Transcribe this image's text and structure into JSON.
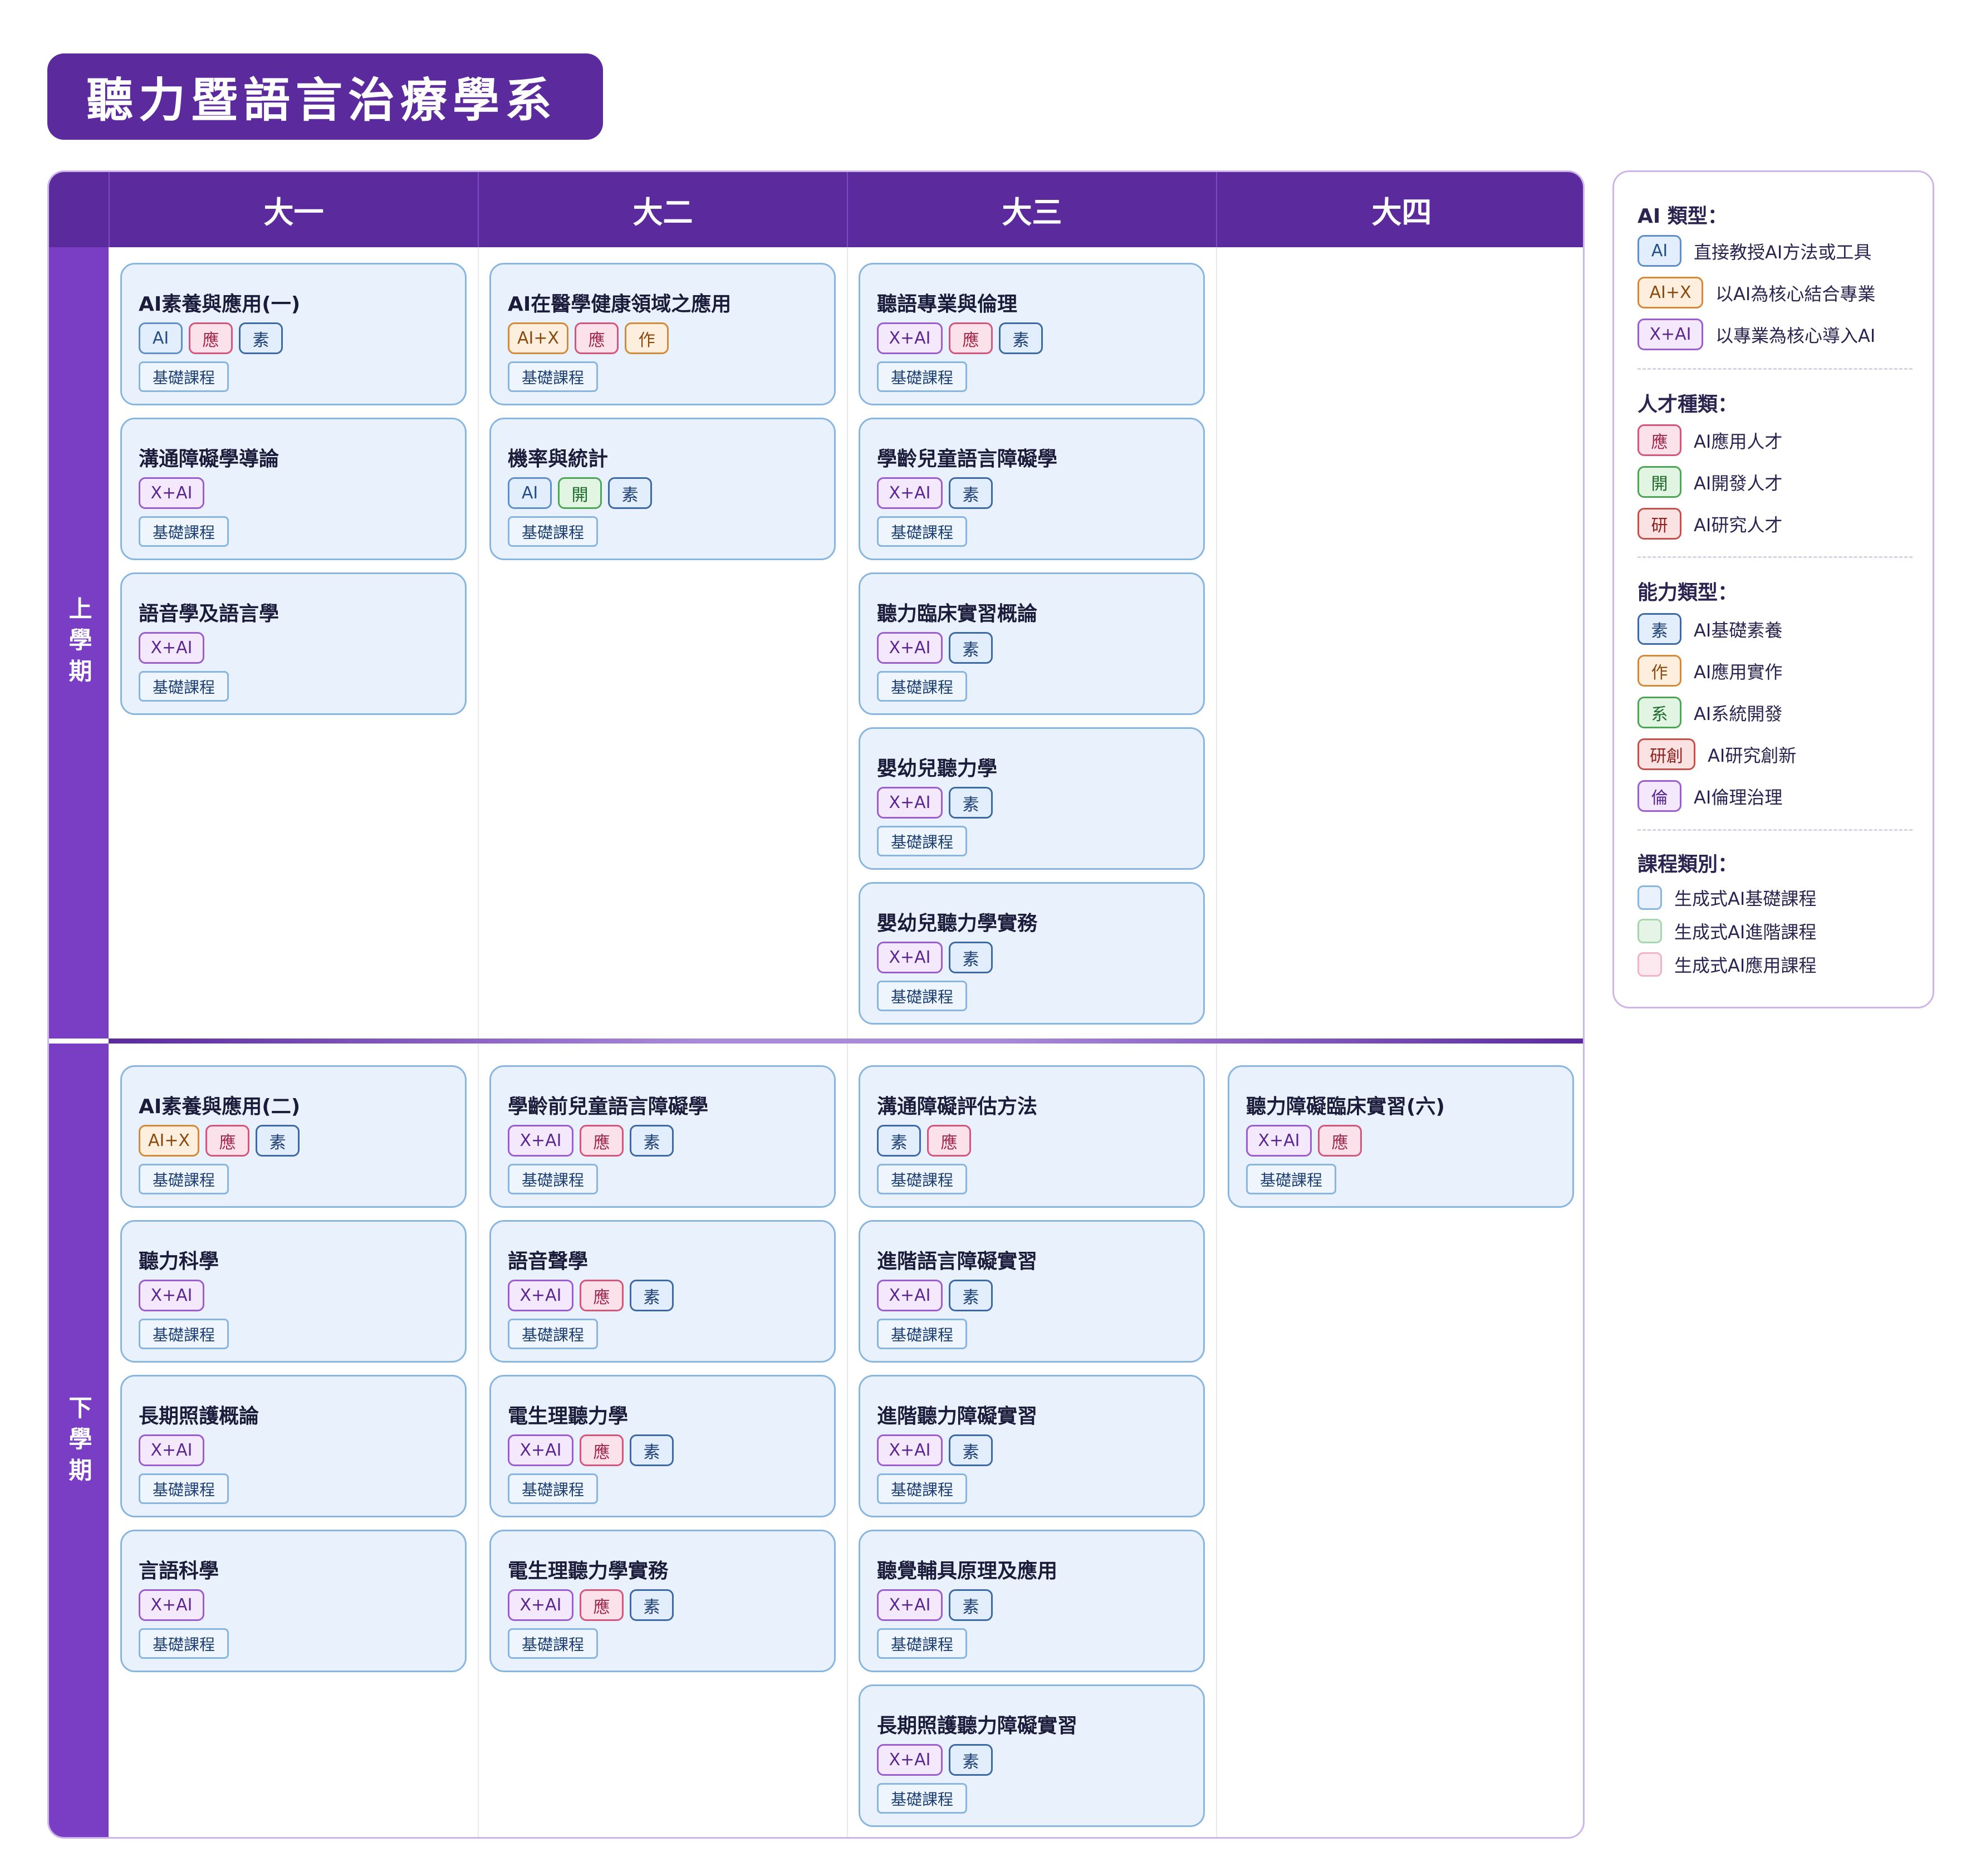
{
  "title": "聽力暨語言治療學系",
  "years": [
    "大一",
    "大二",
    "大三",
    "大四"
  ],
  "semesters": [
    "上學期",
    "下學期"
  ],
  "courses": {
    "s1y1": [
      {
        "name": "AI素養與應用(一)",
        "tags": [
          {
            "t": "ai",
            "l": "AI"
          },
          {
            "t": "ying",
            "l": "應"
          },
          {
            "t": "su",
            "l": "素"
          }
        ],
        "category": "基礎課程"
      },
      {
        "name": "溝通障礙學導論",
        "tags": [
          {
            "t": "xai",
            "l": "X+AI"
          }
        ],
        "category": "基礎課程"
      },
      {
        "name": "語音學及語言學",
        "tags": [
          {
            "t": "xai",
            "l": "X+AI"
          }
        ],
        "category": "基礎課程"
      }
    ],
    "s1y2": [
      {
        "name": "AI在醫學健康領域之應用",
        "tags": [
          {
            "t": "aix",
            "l": "AI+X"
          },
          {
            "t": "ying",
            "l": "應"
          },
          {
            "t": "zuo",
            "l": "作"
          }
        ],
        "category": "基礎課程"
      },
      {
        "name": "機率與統計",
        "tags": [
          {
            "t": "ai",
            "l": "AI"
          },
          {
            "t": "kai",
            "l": "開"
          },
          {
            "t": "su",
            "l": "素"
          }
        ],
        "category": "基礎課程"
      }
    ],
    "s1y3": [
      {
        "name": "聽語專業與倫理",
        "tags": [
          {
            "t": "xai",
            "l": "X+AI"
          },
          {
            "t": "ying",
            "l": "應"
          },
          {
            "t": "su",
            "l": "素"
          }
        ],
        "category": "基礎課程"
      },
      {
        "name": "學齡兒童語言障礙學",
        "tags": [
          {
            "t": "xai",
            "l": "X+AI"
          },
          {
            "t": "su",
            "l": "素"
          }
        ],
        "category": "基礎課程"
      },
      {
        "name": "聽力臨床實習概論",
        "tags": [
          {
            "t": "xai",
            "l": "X+AI"
          },
          {
            "t": "su",
            "l": "素"
          }
        ],
        "category": "基礎課程"
      },
      {
        "name": "嬰幼兒聽力學",
        "tags": [
          {
            "t": "xai",
            "l": "X+AI"
          },
          {
            "t": "su",
            "l": "素"
          }
        ],
        "category": "基礎課程"
      },
      {
        "name": "嬰幼兒聽力學實務",
        "tags": [
          {
            "t": "xai",
            "l": "X+AI"
          },
          {
            "t": "su",
            "l": "素"
          }
        ],
        "category": "基礎課程"
      }
    ],
    "s1y4": [],
    "s2y1": [
      {
        "name": "AI素養與應用(二)",
        "tags": [
          {
            "t": "aix",
            "l": "AI+X"
          },
          {
            "t": "ying",
            "l": "應"
          },
          {
            "t": "su",
            "l": "素"
          }
        ],
        "category": "基礎課程"
      },
      {
        "name": "聽力科學",
        "tags": [
          {
            "t": "xai",
            "l": "X+AI"
          }
        ],
        "category": "基礎課程"
      },
      {
        "name": "長期照護概論",
        "tags": [
          {
            "t": "xai",
            "l": "X+AI"
          }
        ],
        "category": "基礎課程"
      },
      {
        "name": "言語科學",
        "tags": [
          {
            "t": "xai",
            "l": "X+AI"
          }
        ],
        "category": "基礎課程"
      }
    ],
    "s2y2": [
      {
        "name": "學齡前兒童語言障礙學",
        "tags": [
          {
            "t": "xai",
            "l": "X+AI"
          },
          {
            "t": "ying",
            "l": "應"
          },
          {
            "t": "su",
            "l": "素"
          }
        ],
        "category": "基礎課程"
      },
      {
        "name": "語音聲學",
        "tags": [
          {
            "t": "xai",
            "l": "X+AI"
          },
          {
            "t": "ying",
            "l": "應"
          },
          {
            "t": "su",
            "l": "素"
          }
        ],
        "category": "基礎課程"
      },
      {
        "name": "電生理聽力學",
        "tags": [
          {
            "t": "xai",
            "l": "X+AI"
          },
          {
            "t": "ying",
            "l": "應"
          },
          {
            "t": "su",
            "l": "素"
          }
        ],
        "category": "基礎課程"
      },
      {
        "name": "電生理聽力學實務",
        "tags": [
          {
            "t": "xai",
            "l": "X+AI"
          },
          {
            "t": "ying",
            "l": "應"
          },
          {
            "t": "su",
            "l": "素"
          }
        ],
        "category": "基礎課程"
      }
    ],
    "s2y3": [
      {
        "name": "溝通障礙評估方法",
        "tags": [
          {
            "t": "su",
            "l": "素"
          },
          {
            "t": "ying",
            "l": "應"
          }
        ],
        "category": "基礎課程"
      },
      {
        "name": "進階語言障礙實習",
        "tags": [
          {
            "t": "xai",
            "l": "X+AI"
          },
          {
            "t": "su",
            "l": "素"
          }
        ],
        "category": "基礎課程"
      },
      {
        "name": "進階聽力障礙實習",
        "tags": [
          {
            "t": "xai",
            "l": "X+AI"
          },
          {
            "t": "su",
            "l": "素"
          }
        ],
        "category": "基礎課程"
      },
      {
        "name": "聽覺輔具原理及應用",
        "tags": [
          {
            "t": "xai",
            "l": "X+AI"
          },
          {
            "t": "su",
            "l": "素"
          }
        ],
        "category": "基礎課程"
      },
      {
        "name": "長期照護聽力障礙實習",
        "tags": [
          {
            "t": "xai",
            "l": "X+AI"
          },
          {
            "t": "su",
            "l": "素"
          }
        ],
        "category": "基礎課程"
      }
    ],
    "s2y4": [
      {
        "name": "聽力障礙臨床實習(六)",
        "tags": [
          {
            "t": "xai",
            "l": "X+AI"
          },
          {
            "t": "ying",
            "l": "應"
          }
        ],
        "category": "基礎課程"
      }
    ]
  },
  "legend": {
    "ai_type": {
      "heading": "AI 類型：",
      "items": [
        {
          "t": "ai",
          "l": "AI",
          "desc": "直接教授AI方法或工具"
        },
        {
          "t": "aix",
          "l": "AI+X",
          "desc": "以AI為核心結合專業"
        },
        {
          "t": "xai",
          "l": "X+AI",
          "desc": "以專業為核心導入AI"
        }
      ]
    },
    "talent": {
      "heading": "人才種類：",
      "items": [
        {
          "t": "ying",
          "l": "應",
          "desc": "AI應用人才"
        },
        {
          "t": "kai",
          "l": "開",
          "desc": "AI開發人才"
        },
        {
          "t": "yan",
          "l": "研",
          "desc": "AI研究人才"
        }
      ]
    },
    "ability": {
      "heading": "能力類型：",
      "items": [
        {
          "t": "su",
          "l": "素",
          "desc": "AI基礎素養"
        },
        {
          "t": "zuo",
          "l": "作",
          "desc": "AI應用實作"
        },
        {
          "t": "xi",
          "l": "系",
          "desc": "AI系統開發"
        },
        {
          "t": "yanchuang",
          "l": "研創",
          "desc": "AI研究創新"
        },
        {
          "t": "lun",
          "l": "倫",
          "desc": "AI倫理治理"
        }
      ]
    },
    "category": {
      "heading": "課程類別：",
      "items": [
        {
          "color": "#e9f1fc",
          "border": "#89b6e0",
          "desc": "生成式AI基礎課程"
        },
        {
          "color": "#e6f4e8",
          "border": "#a7d6ae",
          "desc": "生成式AI進階課程"
        },
        {
          "color": "#fce8ef",
          "border": "#efb4c8",
          "desc": "生成式AI應用課程"
        }
      ]
    }
  }
}
